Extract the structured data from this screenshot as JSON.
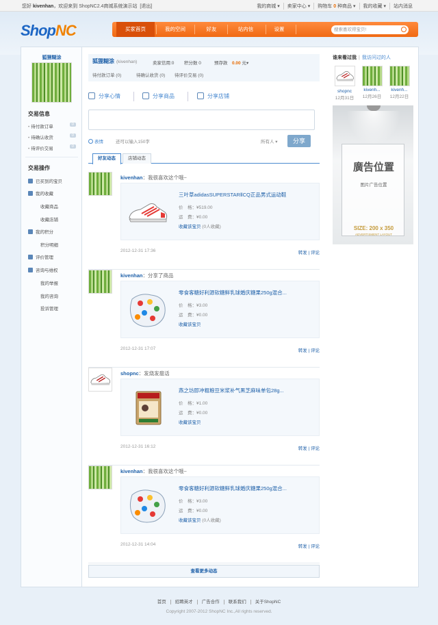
{
  "topbar": {
    "greeting_prefix": "您好",
    "username": "kivenhan",
    "greeting_suffix": "，欢迎来到 ShopNC2.4商城系统演示站",
    "logout": "[退出]",
    "nav": [
      "我的商城 ▾",
      "卖家中心 ▾",
      "购物车",
      "我的收藏 ▾",
      "站内消息"
    ],
    "cart_count": "0",
    "cart_suffix": "种商品 ▾"
  },
  "logo": {
    "part1": "Shop",
    "part2": "NC"
  },
  "mainnav": [
    "买家首页",
    "我的空间",
    "好友",
    "站内信",
    "设置"
  ],
  "search": {
    "placeholder": "搜索喜欢得宝贝!"
  },
  "sidebar": {
    "username": "狐狸糊涂",
    "trade_info_title": "交易信息",
    "trade_info": [
      {
        "label": "待付款订单",
        "count": "0"
      },
      {
        "label": "待确认收货",
        "count": "0"
      },
      {
        "label": "待评价交易",
        "count": "0"
      }
    ],
    "ops_title": "交易操作",
    "ops": [
      {
        "label": "已买到的宝贝",
        "sub": false,
        "icon": "basket-icon"
      },
      {
        "label": "我的收藏",
        "sub": false,
        "icon": "heart-folder-icon"
      },
      {
        "label": "收藏商品",
        "sub": true
      },
      {
        "label": "收藏店铺",
        "sub": true
      },
      {
        "label": "我的积分",
        "sub": false,
        "icon": "calculator-icon"
      },
      {
        "label": "积分明细",
        "sub": true
      },
      {
        "label": "评价管理",
        "sub": false,
        "icon": "heart-icon"
      },
      {
        "label": "咨询与维权",
        "sub": false,
        "icon": "people-icon"
      },
      {
        "label": "我的举报",
        "sub": true
      },
      {
        "label": "我的咨询",
        "sub": true
      },
      {
        "label": "投诉管理",
        "sub": true
      }
    ]
  },
  "usercard": {
    "name": "狐狸糊涂",
    "handle": "(kivenhan)",
    "seller_credit": "卖家信用:0",
    "points": "积分数 0",
    "deposit_label": "预存款",
    "deposit_value": "0.00",
    "deposit_unit": "元▾",
    "pending_pay": "待付款订单 (0)",
    "pending_receive": "待确认收货 (0)",
    "pending_review": "待评价交易 (0)"
  },
  "share": {
    "mood": "分享心情",
    "goods": "分享商品",
    "store": "分享店铺",
    "emoticon": "表情",
    "tip": "还可以输入150字",
    "visibility": "所有人 ▾",
    "button": "分享"
  },
  "tabs": [
    "好友动态",
    "店铺动态"
  ],
  "feeds": [
    {
      "user": "kivenhan",
      "action": "：我很喜欢这个哦~",
      "title": "三叶草adidasSUPERSTARⅡCQ正品男式运动鞋",
      "price": "价　格：¥519.00",
      "shipping": "运　费：¥0.00",
      "link": "收藏该宝贝",
      "extra": " (0人收藏)",
      "time": "2012-12-31 17:36",
      "ops": "转发 | 评论",
      "img": "shoe"
    },
    {
      "user": "kivenhan",
      "action": "：分享了商品",
      "title": "零食客糖好利源软糖鲜乳球婚庆糖果250g混合...",
      "price": "价　格：¥3.00",
      "shipping": "运　费：¥0.00",
      "link": "收藏该宝贝",
      "extra": "",
      "time": "2012-12-31 17:07",
      "ops": "转发 | 评论",
      "img": "candy"
    },
    {
      "user": "shopnc",
      "action": "：发烧发瘟话",
      "title": "燕之坊即冲粗粮豆米浆补气黑芝麻味单包28g...",
      "price": "价　格：¥1.00",
      "shipping": "运　费：¥0.00",
      "link": "收藏该宝贝",
      "extra": "",
      "time": "2012-12-31 16:12",
      "ops": "转发 | 评论",
      "img": "pack"
    },
    {
      "user": "kivenhan",
      "action": "：我很喜欢这个哦~",
      "title": "零食客糖好利源软糖鲜乳球婚庆糖果250g混合...",
      "price": "价　格：¥3.00",
      "shipping": "运　费：¥0.00",
      "link": "收藏该宝贝",
      "extra": " (0人收藏)",
      "time": "2012-12-31 14:04",
      "ops": "转发 | 评论",
      "img": "candy"
    }
  ],
  "more": "查看更多动态",
  "recent": {
    "title": "谁来看过我",
    "other": "我访问过的人",
    "visitors": [
      {
        "name": "shopnc",
        "date": "12月31日"
      },
      {
        "name": "kivenh...",
        "date": "12月26日"
      },
      {
        "name": "kivenh...",
        "date": "12月22日"
      }
    ]
  },
  "ad": {
    "title": "廣告位置",
    "sub": "图片广告位置",
    "size": "SIZE: 200 x 350",
    "tag": "ADVERTISMENT LAYOUT"
  },
  "footer": {
    "links": [
      "首页",
      "招聘英才",
      "广告合作",
      "联系我们",
      "关于ShopNC"
    ],
    "copyright": "Copyright 2007-2012 ShopNC Inc.,All rights reserved."
  }
}
